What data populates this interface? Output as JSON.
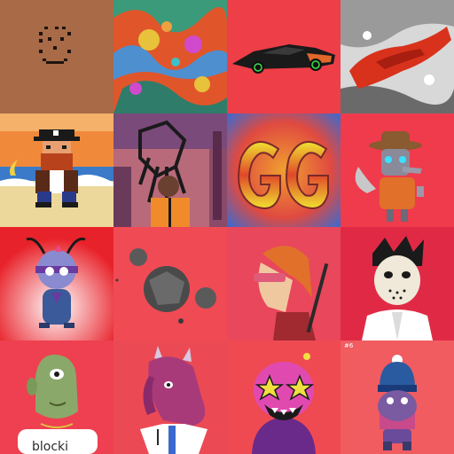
{
  "gallery": {
    "tiles": [
      {
        "id": "pixel-face",
        "bg": "#a86a47"
      },
      {
        "id": "fractal",
        "bg": "#e0562a"
      },
      {
        "id": "supercar",
        "bg": "#ee3e48"
      },
      {
        "id": "paint-smear",
        "bg": "#d8d8d8"
      },
      {
        "id": "pixel-pirate",
        "bg": "#f5b16a"
      },
      {
        "id": "web-head-person",
        "bg": "#9a5a78"
      },
      {
        "id": "gg-letters",
        "bg": "#e64a40"
      },
      {
        "id": "robot-cowboy",
        "bg": "#ef3b4c"
      },
      {
        "id": "ant-character",
        "bg": "#e8222a"
      },
      {
        "id": "spheres",
        "bg": "#f04a55"
      },
      {
        "id": "punk-profile",
        "bg": "#e9475b"
      },
      {
        "id": "hockey-mask",
        "bg": "#e02a45"
      },
      {
        "id": "cyclops-3d",
        "bg": "#ee4050"
      },
      {
        "id": "dog-doctor",
        "bg": "#eb4a55"
      },
      {
        "id": "star-eyed-monster",
        "bg": "#ef4a52"
      },
      {
        "id": "beanie-creature",
        "bg": "#f05c60"
      }
    ],
    "badge_text": "#6",
    "shirt_text": "blocki"
  }
}
